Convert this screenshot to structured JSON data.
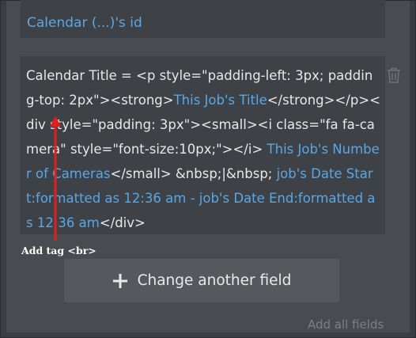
{
  "field_above": {
    "text": "Calendar (...)'s id"
  },
  "expression": {
    "segments": [
      {
        "text": "Calendar Title  =  <p style=\"padding-left: 3px; padding-top: 2px\"><strong>",
        "dynamic": false
      },
      {
        "text": "This Job's Title",
        "dynamic": true
      },
      {
        "text": "</strong></p><div style=\"padding: 3px\"><small><i class=\"fa fa-camera\" style=\"font-size:10px;\"></i> ",
        "dynamic": false
      },
      {
        "text": "This Job's Number of Cameras",
        "dynamic": true
      },
      {
        "text": "</small> &nbsp;|&nbsp; ",
        "dynamic": false
      },
      {
        "text": "job's Date Start:formatted as 12:36 am - job's Date End:formatted as 12:36 am",
        "dynamic": true
      },
      {
        "text": "</div>",
        "dynamic": false
      }
    ]
  },
  "delete_icon": "trash-icon",
  "annotation": {
    "text": "Add  tag <br>",
    "arrow_color": "#e02020"
  },
  "change_field_button": {
    "icon": "plus-icon",
    "label": "Change another field"
  },
  "add_all_fields": {
    "label": "Add all fields"
  }
}
